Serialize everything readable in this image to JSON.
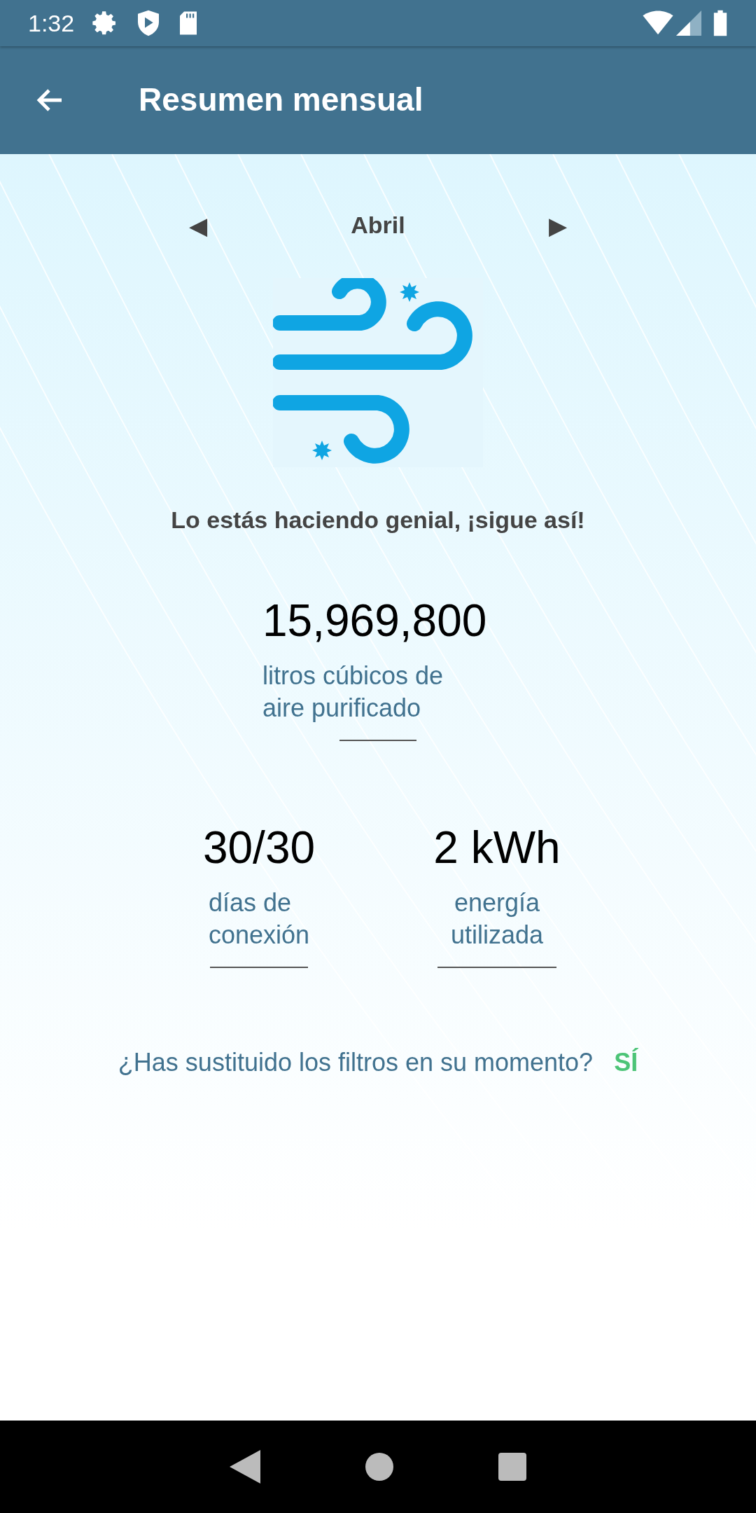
{
  "status_bar": {
    "time": "1:32"
  },
  "app_bar": {
    "title": "Resumen mensual"
  },
  "month": {
    "label": "Abril",
    "prev": "◀",
    "next": "▶"
  },
  "message": "Lo estás haciendo genial, ¡sigue así!",
  "main_stat": {
    "value": "15,969,800",
    "label": "litros cúbicos de\naire purificado"
  },
  "stats": [
    {
      "value": "30/30",
      "label": "días de\nconexión"
    },
    {
      "value": "2 kWh",
      "label": "energía\nutilizada"
    }
  ],
  "filters": {
    "question": "¿Has sustituido los filtros en su momento?",
    "answer": "SÍ",
    "ok": true
  }
}
